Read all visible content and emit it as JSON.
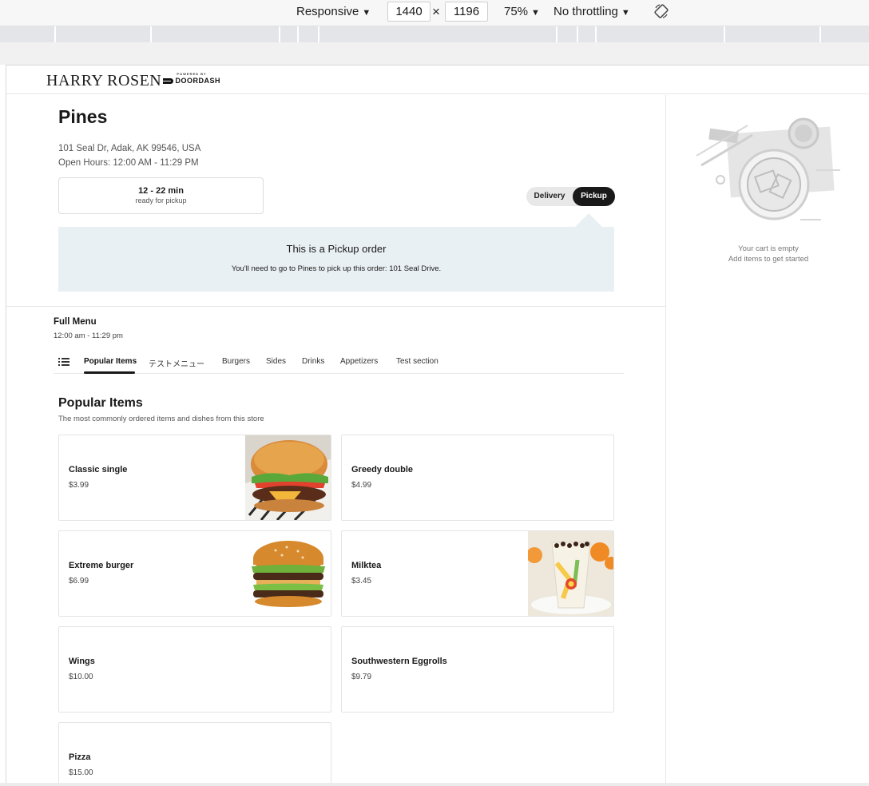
{
  "devtools": {
    "device": "Responsive",
    "width": "1440",
    "times": "×",
    "height": "1196",
    "zoom": "75%",
    "throttling": "No throttling",
    "rotate_icon": "rotate-icon"
  },
  "header": {
    "brand": "HARRY ROSEN",
    "powered_by": "POWERED BY",
    "doordash": "DOORDASH"
  },
  "store": {
    "name": "Pines",
    "address": "101 Seal Dr, Adak, AK 99546, USA",
    "hours": "Open Hours: 12:00 AM - 11:29 PM",
    "eta": "12 - 22 min",
    "eta_sub": "ready for pickup"
  },
  "toggle": {
    "delivery": "Delivery",
    "pickup": "Pickup",
    "selected": "Pickup"
  },
  "pickup_panel": {
    "title": "This is a Pickup order",
    "text": "You'll need to go to Pines to pick up this order: 101 Seal Drive."
  },
  "menu": {
    "title": "Full Menu",
    "hours": "12:00 am - 11:29 pm",
    "tabs": [
      "Popular Items",
      "テストメニュー",
      "Burgers",
      "Sides",
      "Drinks",
      "Appetizers",
      "Test section"
    ],
    "active_tab": "Popular Items"
  },
  "section": {
    "title": "Popular Items",
    "subtitle": "The most commonly ordered items and dishes from this store"
  },
  "items": [
    {
      "name": "Classic single",
      "price": "$3.99",
      "image": "burger-photo"
    },
    {
      "name": "Greedy double",
      "price": "$4.99",
      "image": ""
    },
    {
      "name": "Extreme burger",
      "price": "$6.99",
      "image": "big-burger-photo"
    },
    {
      "name": "Milktea",
      "price": "$3.45",
      "image": "milktea-photo"
    },
    {
      "name": "Wings",
      "price": "$10.00",
      "image": ""
    },
    {
      "name": "Southwestern Eggrolls",
      "price": "$9.79",
      "image": ""
    },
    {
      "name": "Pizza",
      "price": "$15.00",
      "image": ""
    }
  ],
  "cart": {
    "empty_line1": "Your cart is empty",
    "empty_line2": "Add items to get started"
  },
  "colors": {
    "pickup_panel_bg": "#e9f0f3",
    "toggle_active": "#191919"
  }
}
